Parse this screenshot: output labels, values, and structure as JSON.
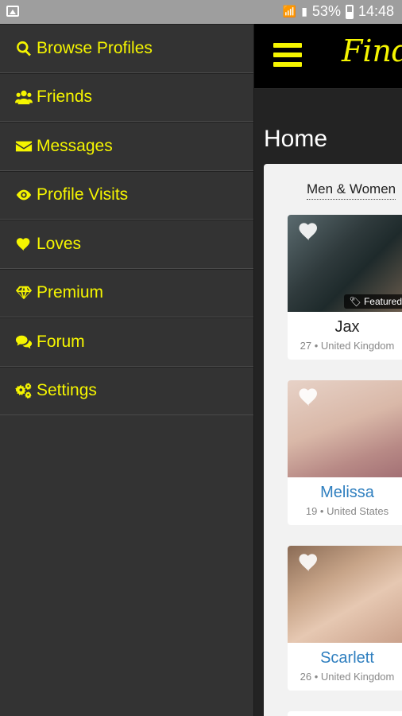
{
  "status_bar": {
    "battery": "53%",
    "time": "14:48"
  },
  "drawer": {
    "items": [
      {
        "label": "Browse Profiles",
        "icon": "search-icon"
      },
      {
        "label": "Friends",
        "icon": "users-icon"
      },
      {
        "label": "Messages",
        "icon": "envelope-icon"
      },
      {
        "label": "Profile Visits",
        "icon": "eye-icon"
      },
      {
        "label": "Loves",
        "icon": "heart-icon"
      },
      {
        "label": "Premium",
        "icon": "diamond-icon"
      },
      {
        "label": "Forum",
        "icon": "chat-icon"
      },
      {
        "label": "Settings",
        "icon": "gears-icon"
      }
    ]
  },
  "header": {
    "brand": "Find"
  },
  "main": {
    "title": "Home",
    "filter": "Men & Women",
    "profiles": [
      {
        "name": "Jax",
        "meta": "27 • United Kingdom",
        "badge": "Featured"
      },
      {
        "name": "Melissa",
        "meta": "19 • United States"
      },
      {
        "name": "Scarlett",
        "meta": "26 • United Kingdom"
      }
    ]
  },
  "colors": {
    "accent": "#f5f500",
    "drawer_bg": "#333333",
    "link": "#2f7fbf"
  }
}
